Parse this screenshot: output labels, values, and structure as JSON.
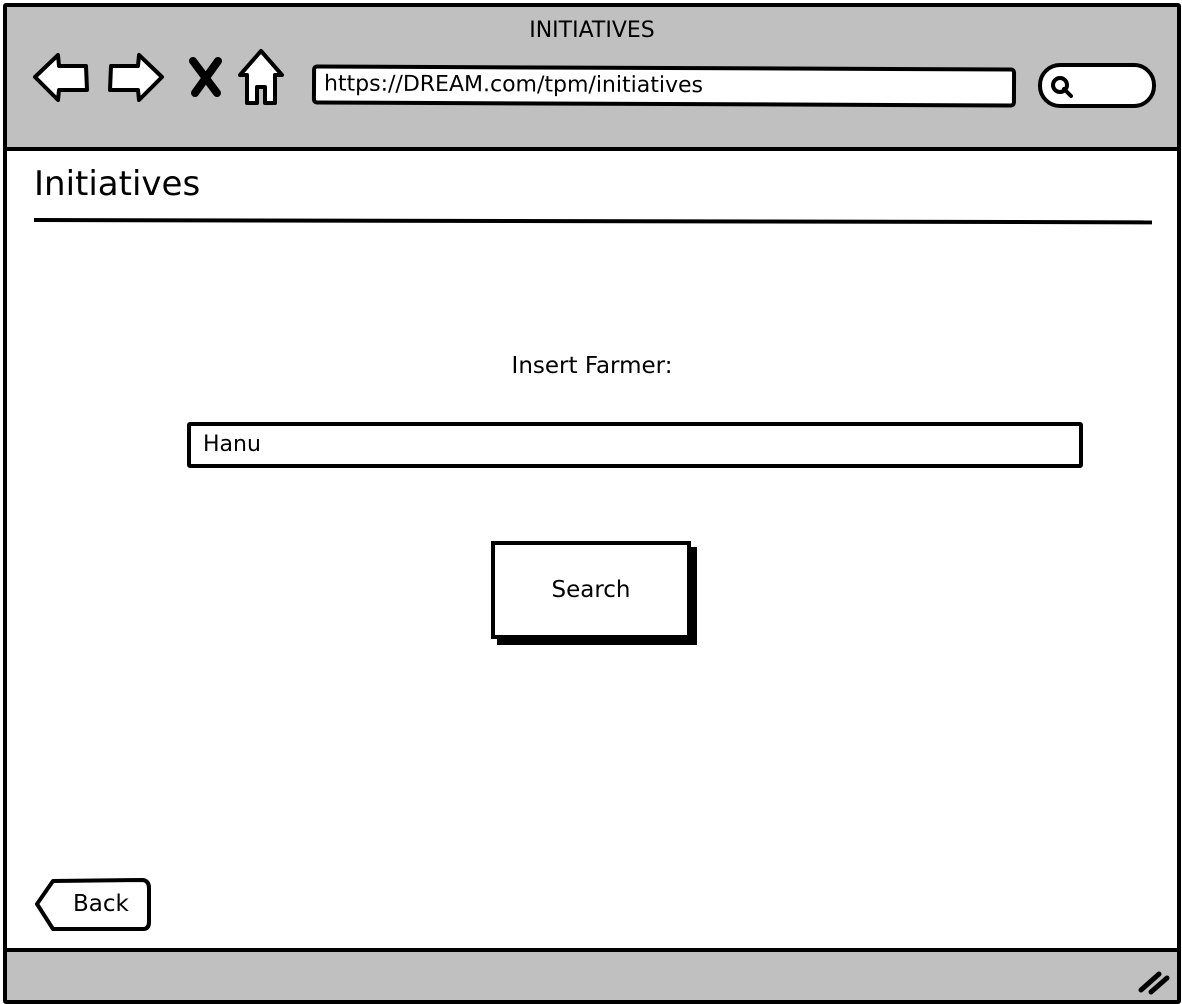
{
  "window": {
    "title": "INITIATIVES"
  },
  "browser": {
    "url": "https://DREAM.com/tpm/initiatives",
    "nav_icons": [
      "back-arrow-icon",
      "forward-arrow-icon",
      "close-icon",
      "home-icon"
    ],
    "search_icon": "search-icon"
  },
  "page": {
    "heading": "Initiatives"
  },
  "form": {
    "farmer_label": "Insert Farmer:",
    "farmer_value": "Hanu",
    "search_label": "Search"
  },
  "footer": {
    "back_label": "Back"
  },
  "colors": {
    "chrome": "#c0c0c0",
    "ink": "#000000",
    "background": "#ffffff"
  }
}
